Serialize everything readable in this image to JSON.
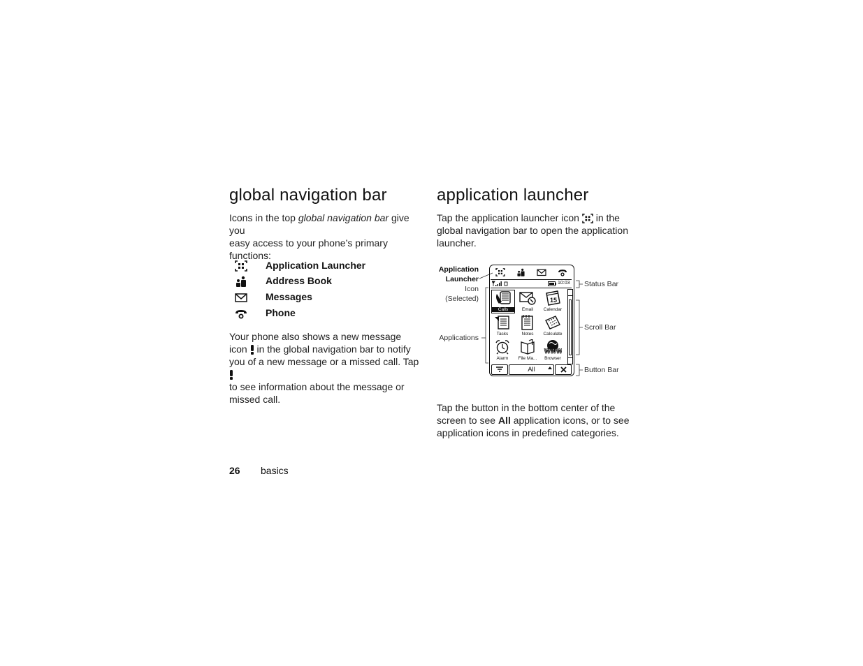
{
  "left": {
    "heading": "global navigation bar",
    "intro_1": "Icons in the top ",
    "intro_em": "global navigation bar",
    "intro_2": " give you",
    "intro_3": "easy access to your phone’s primary",
    "intro_4": "functions:",
    "nav_items": [
      {
        "label": "Application Launcher",
        "icon": "app-launcher-icon"
      },
      {
        "label": "Address Book",
        "icon": "address-book-icon"
      },
      {
        "label": "Messages",
        "icon": "messages-icon"
      },
      {
        "label": "Phone",
        "icon": "phone-icon"
      }
    ],
    "p2_1": "Your phone also shows a new message",
    "p2_2a": "icon ",
    "p2_2b": " in the global navigation bar to notify",
    "p2_3a": "you of a new message or a missed call. Tap ",
    "p2_4": "to see information about the message or",
    "p2_5": "missed call."
  },
  "right": {
    "heading": "application launcher",
    "p1_1a": "Tap the application launcher icon ",
    "p1_1b": " in the",
    "p1_2": "global navigation bar to open the application",
    "p1_3": "launcher.",
    "p2_1": "Tap the button in the bottom center of the",
    "p2_2a": "screen to see ",
    "p2_2b": "All",
    "p2_2c": " application icons, or to see",
    "p2_3": "application icons in predefined categories."
  },
  "figure": {
    "callouts": {
      "app_launcher_1": "Application",
      "app_launcher_2": "Launcher",
      "icon_1": "Icon",
      "icon_2": "(Selected)",
      "applications": "Applications",
      "status_bar": "Status Bar",
      "scroll_bar": "Scroll Bar",
      "button_bar": "Button Bar"
    },
    "status_time": "10:03",
    "apps": [
      {
        "label": "Calls",
        "selected": true
      },
      {
        "label": "Email"
      },
      {
        "label": "Calendar"
      },
      {
        "label": "Tasks"
      },
      {
        "label": "Notes"
      },
      {
        "label": "Calculate"
      },
      {
        "label": "Alarm"
      },
      {
        "label": "File Ma..."
      },
      {
        "label": "Browser"
      }
    ],
    "button_bar_center": "All",
    "calendar_day": "15",
    "browser_mark": "WWW"
  },
  "footer": {
    "page_number": "26",
    "section": "basics"
  }
}
